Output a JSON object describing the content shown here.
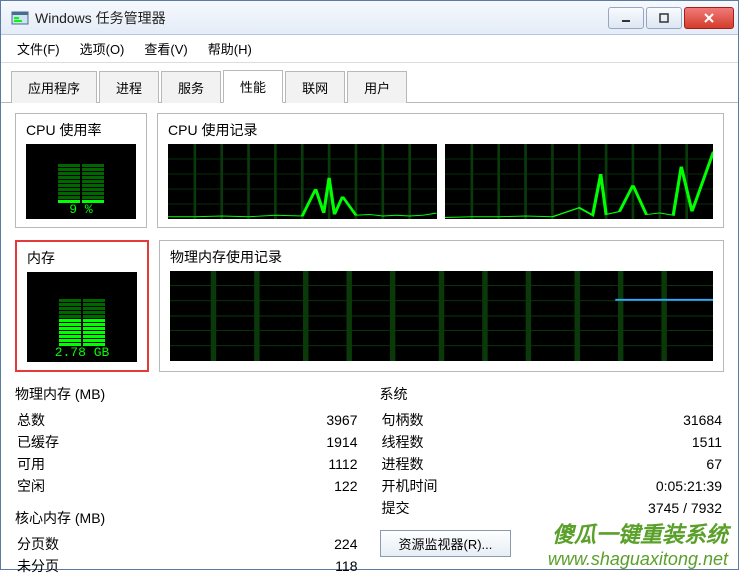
{
  "window": {
    "title": "Windows 任务管理器"
  },
  "menu": {
    "file": "文件(F)",
    "options": "选项(O)",
    "view": "查看(V)",
    "help": "帮助(H)"
  },
  "tabs": {
    "apps": "应用程序",
    "procs": "进程",
    "services": "服务",
    "perf": "性能",
    "net": "联网",
    "users": "用户"
  },
  "gauges": {
    "cpu": {
      "label": "CPU 使用率",
      "value": "9 %"
    },
    "mem": {
      "label": "内存",
      "value": "2.78 GB"
    }
  },
  "charts": {
    "cpu_history": {
      "label": "CPU 使用记录"
    },
    "mem_history": {
      "label": "物理内存使用记录"
    }
  },
  "physmem": {
    "title": "物理内存 (MB)",
    "rows": {
      "total": {
        "k": "总数",
        "v": "3967"
      },
      "cached": {
        "k": "已缓存",
        "v": "1914"
      },
      "avail": {
        "k": "可用",
        "v": "1112"
      },
      "free": {
        "k": "空闲",
        "v": "122"
      }
    }
  },
  "kernelmem": {
    "title": "核心内存 (MB)",
    "rows": {
      "paged": {
        "k": "分页数",
        "v": "224"
      },
      "nonpaged": {
        "k": "未分页",
        "v": "118"
      }
    }
  },
  "system": {
    "title": "系统",
    "rows": {
      "handles": {
        "k": "句柄数",
        "v": "31684"
      },
      "threads": {
        "k": "线程数",
        "v": "1511"
      },
      "procs": {
        "k": "进程数",
        "v": "67"
      },
      "uptime": {
        "k": "开机时间",
        "v": "0:05:21:39"
      },
      "commit": {
        "k": "提交",
        "v": "3745 / 7932"
      }
    }
  },
  "resmon_btn": "资源监视器(R)...",
  "watermark": {
    "l1": "傻瓜一键重装系统",
    "l2": "www.shaguaxitong.net"
  },
  "chart_data": [
    {
      "type": "line",
      "title": "CPU 使用记录 (core 1)",
      "xlabel": "",
      "ylabel": "%",
      "ylim": [
        0,
        100
      ],
      "x": [
        0,
        10,
        20,
        30,
        40,
        50,
        55,
        58,
        60,
        62,
        65,
        70,
        75,
        80,
        85,
        90,
        95,
        100
      ],
      "values": [
        3,
        3,
        4,
        3,
        5,
        4,
        40,
        8,
        55,
        6,
        30,
        5,
        6,
        4,
        5,
        4,
        5,
        8
      ]
    },
    {
      "type": "line",
      "title": "CPU 使用记录 (core 2)",
      "xlabel": "",
      "ylabel": "%",
      "ylim": [
        0,
        100
      ],
      "x": [
        0,
        10,
        20,
        30,
        40,
        50,
        55,
        58,
        60,
        65,
        70,
        75,
        80,
        85,
        88,
        92,
        96,
        100
      ],
      "values": [
        2,
        3,
        3,
        4,
        3,
        15,
        5,
        60,
        6,
        10,
        45,
        6,
        8,
        5,
        70,
        10,
        50,
        90
      ]
    },
    {
      "type": "line",
      "title": "物理内存使用记录",
      "xlabel": "",
      "ylabel": "GB",
      "ylim": [
        0,
        4
      ],
      "x": [
        0,
        100
      ],
      "values": [
        2.78,
        2.78
      ]
    }
  ]
}
